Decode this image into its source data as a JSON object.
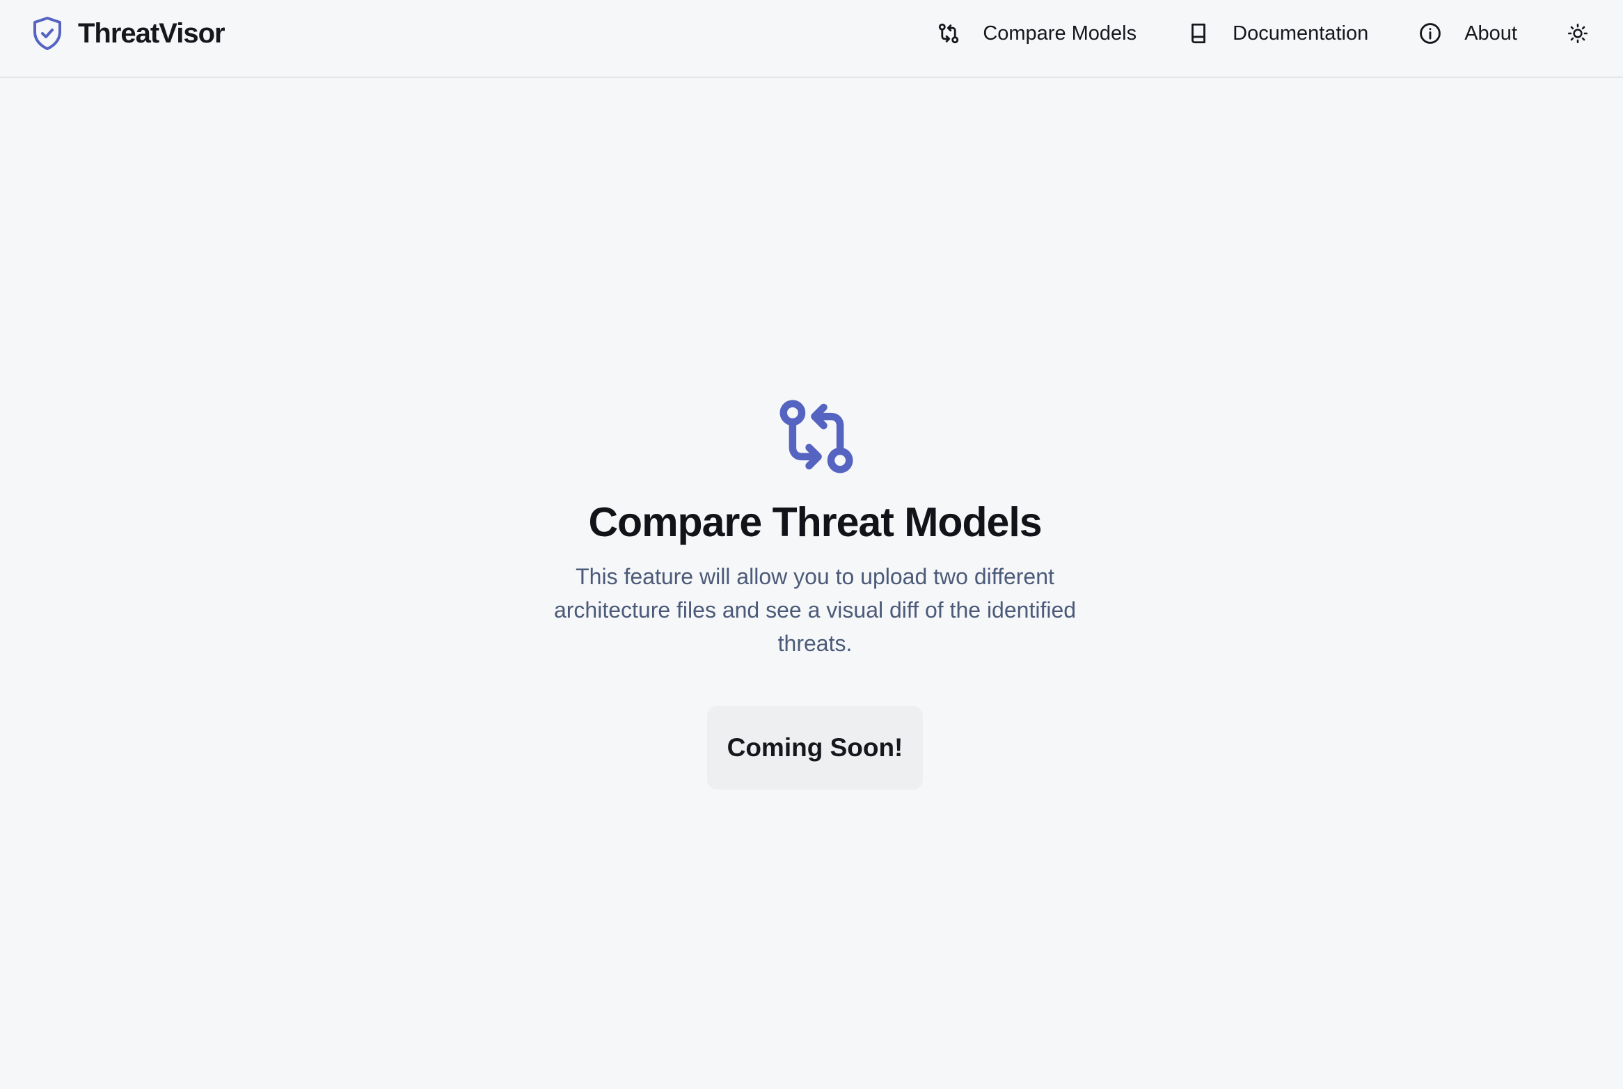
{
  "header": {
    "brand_name": "ThreatVisor",
    "brand_icon": "shield-check-icon",
    "nav": [
      {
        "label": "Compare Models",
        "icon": "git-compare-icon"
      },
      {
        "label": "Documentation",
        "icon": "book-icon"
      },
      {
        "label": "About",
        "icon": "info-icon"
      }
    ],
    "theme_toggle_icon": "sun-icon"
  },
  "main": {
    "hero_icon": "git-compare-icon",
    "title": "Compare Threat Models",
    "description": "This feature will allow you to upload two different architecture files and see a visual diff of the identified threats.",
    "button_label": "Coming Soon!"
  },
  "colors": {
    "accent": "#5563c1",
    "background": "#f6f7f9",
    "text": "#111318",
    "muted_text": "#4b5a78",
    "button_bg": "#eeeff1"
  }
}
